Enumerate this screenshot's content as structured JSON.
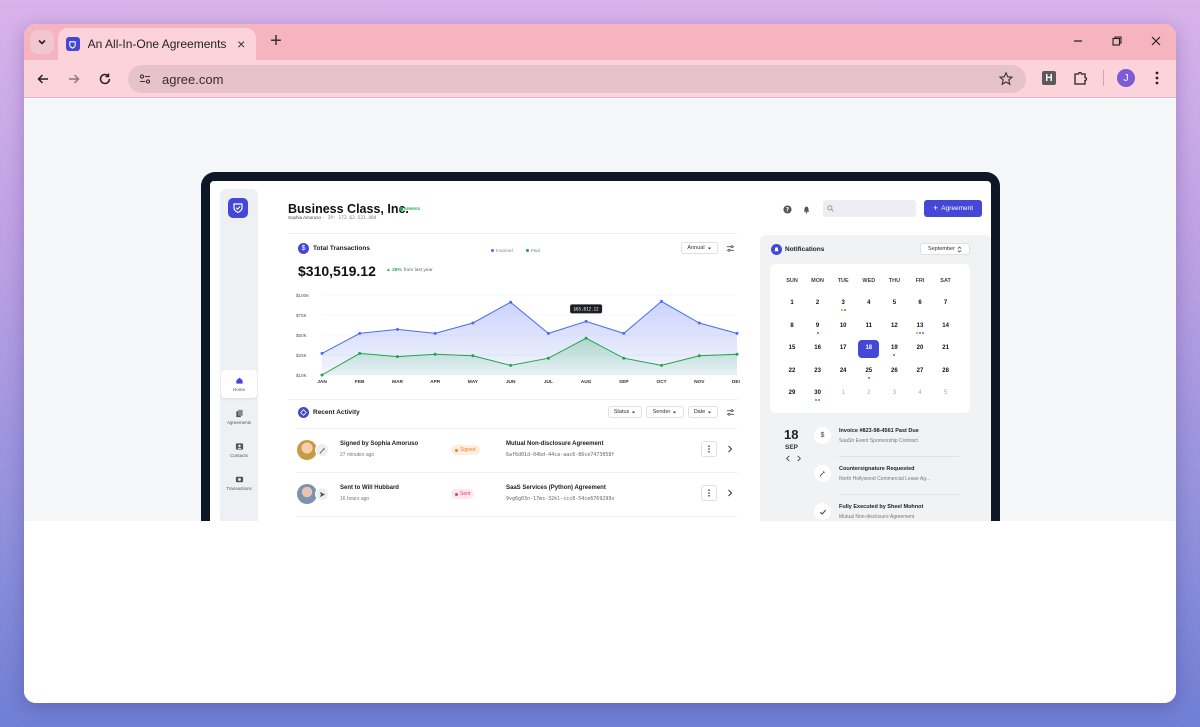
{
  "browser": {
    "tab_title": "An All-In-One Agreements Platform",
    "url": "agree.com",
    "profile_initial": "J",
    "ext_letter": "H",
    "new_tab_glyph": "+",
    "close_glyph": "×"
  },
  "header": {
    "company": "Business Class, Inc.",
    "verified": "VERIFIED",
    "owner": "Sophia Amoruso",
    "ip": "· IP: 172.62.521.404",
    "agreement_button": "Agreement"
  },
  "sidebar": {
    "items": [
      {
        "label": "Home",
        "icon": "home-icon",
        "active": true
      },
      {
        "label": "Agreements",
        "icon": "documents-icon",
        "active": false
      },
      {
        "label": "Contacts",
        "icon": "contacts-icon",
        "active": false
      },
      {
        "label": "Transactions",
        "icon": "transactions-icon",
        "active": false
      }
    ]
  },
  "transactions": {
    "title": "Total Transactions",
    "legend": [
      {
        "name": "Invoiced",
        "color": "#4a6cf7"
      },
      {
        "name": "Paid",
        "color": "#22a447"
      }
    ],
    "period": "Annual",
    "amount": "$310,519.12",
    "delta_pct": "▲ 26%",
    "delta_text": "from last year"
  },
  "chart_data": {
    "type": "area",
    "categories": [
      "JAN",
      "FEB",
      "MAR",
      "APR",
      "MAY",
      "JUN",
      "JUL",
      "AUG",
      "SEP",
      "OCT",
      "NOV",
      "DEC"
    ],
    "y_ticks": [
      "$100K",
      "$75K",
      "$50K",
      "$25K",
      "$10K"
    ],
    "ylim": [
      0,
      100
    ],
    "series": [
      {
        "name": "Invoiced",
        "color": "#4a6cf7",
        "values": [
          27,
          52,
          57,
          52,
          65,
          91,
          52,
          67,
          52,
          92,
          65,
          52
        ]
      },
      {
        "name": "Paid",
        "color": "#22a447",
        "values": [
          0,
          27,
          23,
          26,
          24,
          12,
          21,
          46,
          21,
          12,
          24,
          26
        ]
      }
    ],
    "tooltip": {
      "label": "$65,012.12",
      "index": 7
    }
  },
  "activity": {
    "title": "Recent Activity",
    "filters": [
      "Status",
      "Sender",
      "Date"
    ],
    "rows": [
      {
        "title": "Signed by Sophia Amoruso",
        "time": "27 minutes ago",
        "status": "Signed",
        "status_color": "#f0831e",
        "status_bg": "#fdeee0",
        "doc": "Mutual Non-disclosure Agreement",
        "hash": "6af6d01d-04bd-44ca-aac6-86ce7473058f"
      },
      {
        "title": "Sent to Will Hubbard",
        "time": "16 hours ago",
        "status": "Sent",
        "status_color": "#e5416f",
        "status_bg": "#fde6ec",
        "doc": "SaaS Services (Python) Agreement",
        "hash": "9vg6g03n-17ms-32kl-ccc8-54ce6769299x"
      }
    ]
  },
  "notifications": {
    "title": "Notifications",
    "month": "September",
    "weekdays": [
      "SUN",
      "MON",
      "TUE",
      "WED",
      "THU",
      "FRI",
      "SAT"
    ],
    "weeks": [
      [
        "1",
        "2",
        "3",
        "4",
        "5",
        "6",
        "7"
      ],
      [
        "8",
        "9",
        "10",
        "11",
        "12",
        "13",
        "14"
      ],
      [
        "15",
        "16",
        "17",
        "18",
        "19",
        "20",
        "21"
      ],
      [
        "22",
        "23",
        "24",
        "25",
        "26",
        "27",
        "28"
      ],
      [
        "29",
        "30",
        "1",
        "2",
        "3",
        "4",
        "5"
      ]
    ],
    "selected_day": "18",
    "selected_month": "SEP",
    "items": [
      {
        "title": "Invoice #823-98-4561 Past Due",
        "subtitle": "SaaStr Event Sponsorship Contract",
        "icon": "dollar-icon"
      },
      {
        "title": "Countersignature Requested",
        "subtitle": "North Hollywood Commercial Lease Ag...",
        "icon": "pen-icon"
      },
      {
        "title": "Fully Executed by Sheel Mohnot",
        "subtitle": "Mutual Non-disclosure Agreement",
        "icon": "check-icon"
      }
    ]
  }
}
